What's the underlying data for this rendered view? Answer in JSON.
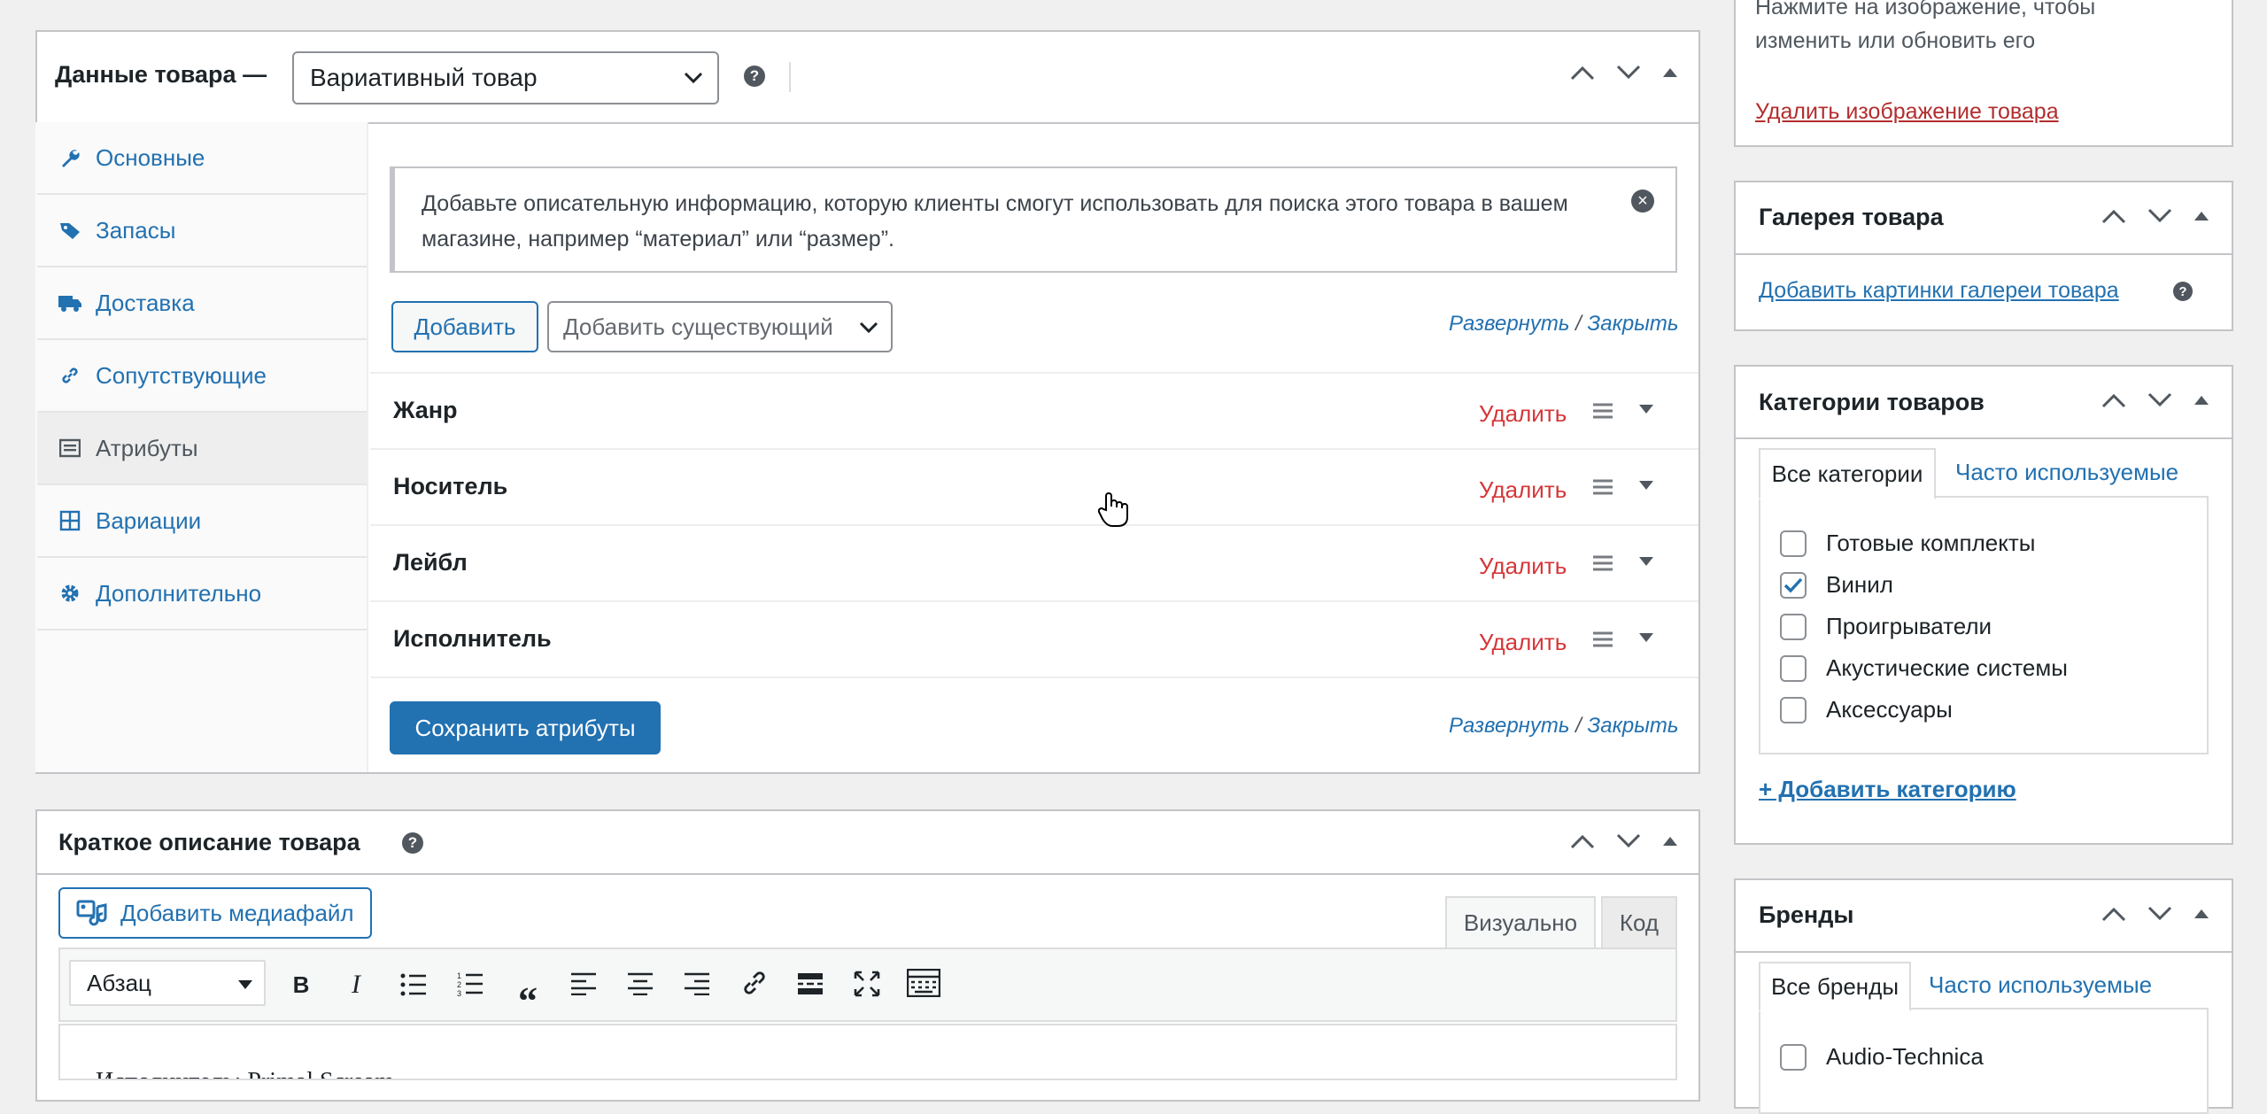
{
  "product_data": {
    "title": "Данные товара —",
    "type_select": "Вариативный товар",
    "tabs": [
      {
        "label": "Основные",
        "icon": "wrench-icon"
      },
      {
        "label": "Запасы",
        "icon": "tag-icon"
      },
      {
        "label": "Доставка",
        "icon": "truck-icon"
      },
      {
        "label": "Сопутствующие",
        "icon": "link-icon"
      },
      {
        "label": "Атрибуты",
        "icon": "list-icon"
      },
      {
        "label": "Вариации",
        "icon": "grid-icon"
      },
      {
        "label": "Дополнительно",
        "icon": "gear-icon"
      }
    ],
    "notice": "Добавьте описательную информацию, которую клиенты смогут использовать для поиска этого товара в вашем магазине, например “материал” или “размер”.",
    "add_button": "Добавить",
    "add_existing": "Добавить существующий",
    "expand": "Развернуть",
    "separator": "/",
    "collapse": "Закрыть",
    "attributes": [
      {
        "name": "Жанр",
        "remove": "Удалить"
      },
      {
        "name": "Носитель",
        "remove": "Удалить"
      },
      {
        "name": "Лейбл",
        "remove": "Удалить"
      },
      {
        "name": "Исполнитель",
        "remove": "Удалить"
      }
    ],
    "save_button": "Сохранить атрибуты"
  },
  "short_desc": {
    "title": "Краткое описание товара",
    "add_media": "Добавить медиафайл",
    "tab_visual": "Визуально",
    "tab_code": "Код",
    "format_select": "Абзац",
    "content_preview": "Исполнитель: Primal Scream"
  },
  "image_box": {
    "hint_line1": "Нажмите на изображение, чтобы",
    "hint_line2": "изменить или обновить его",
    "remove_link": "Удалить изображение товара"
  },
  "gallery": {
    "title": "Галерея товара",
    "add_link": "Добавить картинки галереи товара"
  },
  "categories": {
    "title": "Категории товаров",
    "tab_all": "Все категории",
    "tab_popular": "Часто используемые",
    "items": [
      {
        "label": "Готовые комплекты",
        "checked": false
      },
      {
        "label": "Винил",
        "checked": true
      },
      {
        "label": "Проигрыватели",
        "checked": false
      },
      {
        "label": "Акустические системы",
        "checked": false
      },
      {
        "label": "Аксессуары",
        "checked": false
      }
    ],
    "add_link": "+ Добавить категорию"
  },
  "brands": {
    "title": "Бренды",
    "tab_all": "Все бренды",
    "tab_popular": "Часто используемые",
    "items": [
      {
        "label": "Audio-Technica",
        "checked": false
      }
    ]
  },
  "colors": {
    "accent": "#2271b1",
    "danger": "#d63638",
    "border": "#c3c4c7",
    "bg": "#f0f0f1"
  }
}
